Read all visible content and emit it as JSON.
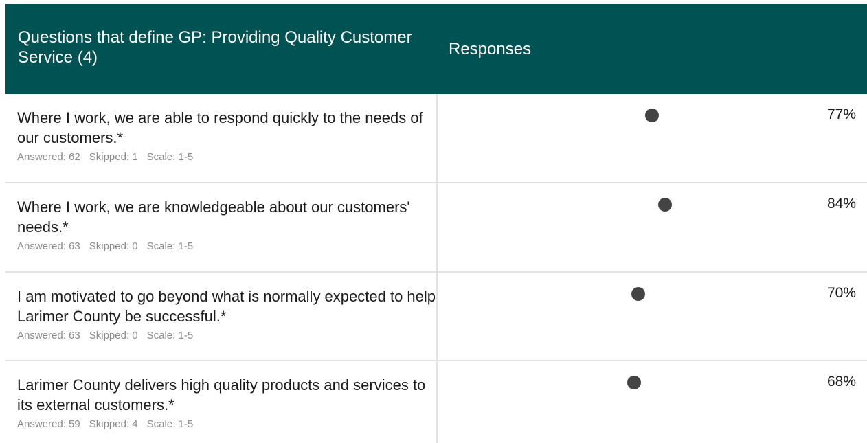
{
  "header": {
    "question_title": "Questions that define GP: Providing Quality Customer Service (4)",
    "responses_title": "Responses"
  },
  "labels": {
    "answered": "Answered:",
    "skipped": "Skipped:",
    "scale": "Scale:"
  },
  "rows": [
    {
      "question": "Where I work, we are able to respond quickly to the needs of our customers.*",
      "answered": "62",
      "skipped": "1",
      "scale": "1-5",
      "percent": "77%",
      "value": 0.77
    },
    {
      "question": "Where I work, we are knowledgeable about our customers' needs.*",
      "answered": "63",
      "skipped": "0",
      "scale": "1-5",
      "percent": "84%",
      "value": 0.84
    },
    {
      "question": "I am motivated to go beyond what is normally expected to help Larimer County be successful.*",
      "answered": "63",
      "skipped": "0",
      "scale": "1-5",
      "percent": "70%",
      "value": 0.7
    },
    {
      "question": "Larimer County delivers high quality products and services to its external customers.*",
      "answered": "59",
      "skipped": "4",
      "scale": "1-5",
      "percent": "68%",
      "value": 0.68
    }
  ],
  "colors": {
    "header_bg": "#015252",
    "dot": "#444444",
    "divider": "#e3e3e3",
    "meta_text": "#8a8a8a"
  }
}
